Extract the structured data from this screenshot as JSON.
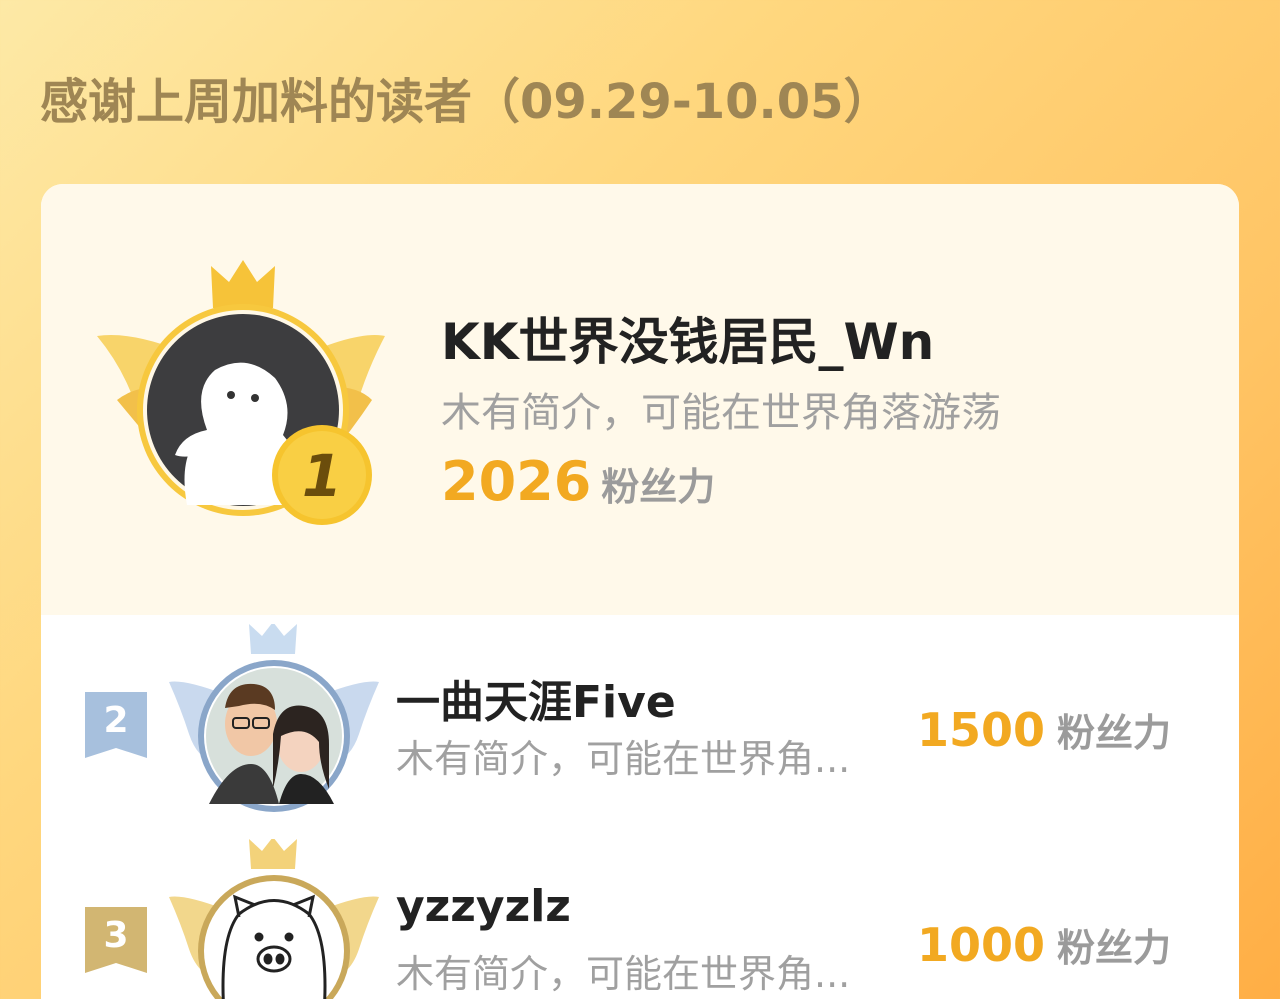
{
  "page": {
    "title": "感谢上周加料的读者（09.29-10.05）"
  },
  "colors": {
    "accent": "#f2a921",
    "title": "#9f8654",
    "gold": "#f5c53a",
    "silver_blue": "#8aa6c9"
  },
  "readers": [
    {
      "rank": "1",
      "name": "KK世界没钱居民_Wn",
      "intro": "木有简介，可能在世界角落游荡",
      "fan_value": "2026",
      "fan_unit": "粉丝力",
      "avatar": "ghost-avatar-icon"
    },
    {
      "rank": "2",
      "name": "一曲天涯Five",
      "intro": "木有简介，可能在世界角...",
      "fan_value": "1500",
      "fan_unit": "粉丝力",
      "avatar": "couple-photo-avatar"
    },
    {
      "rank": "3",
      "name": "yzzyzlz",
      "intro": "木有简介，可能在世界角...",
      "fan_value": "1000",
      "fan_unit": "粉丝力",
      "avatar": "pig-avatar-icon"
    }
  ]
}
